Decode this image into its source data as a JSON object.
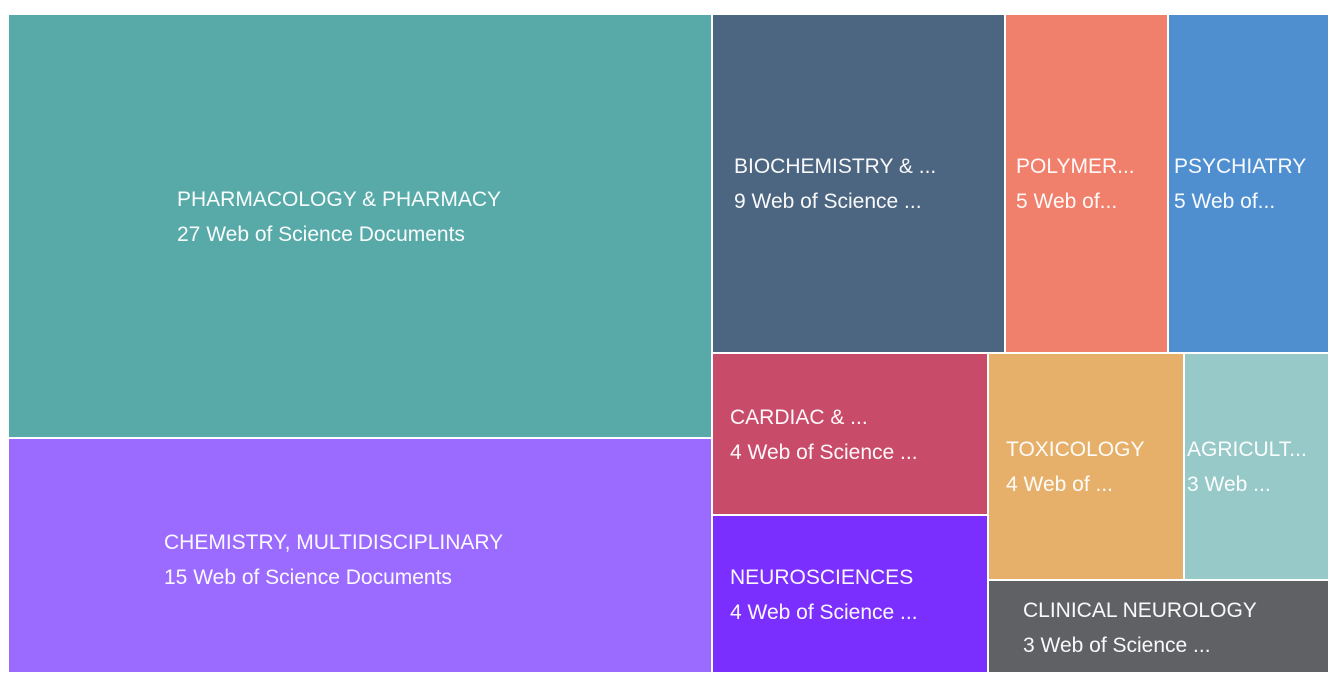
{
  "chart_data": {
    "type": "treemap",
    "title": "",
    "unit_label": "Web of Science Documents",
    "items": [
      {
        "name": "PHARMACOLOGY & PHARMACY",
        "value": 27,
        "label": "PHARMACOLOGY & PHARMACY",
        "sub": "27 Web of Science Documents",
        "color": "#58AAA8"
      },
      {
        "name": "CHEMISTRY, MULTIDISCIPLINARY",
        "value": 15,
        "label": "CHEMISTRY, MULTIDISCIPLINARY",
        "sub": "15 Web of Science Documents",
        "color": "#9B6BFF"
      },
      {
        "name": "BIOCHEMISTRY & ...",
        "value": 9,
        "label": "BIOCHEMISTRY & ...",
        "sub": "9 Web of Science ...",
        "color": "#4C6580"
      },
      {
        "name": "POLYMER...",
        "value": 5,
        "label": "POLYMER...",
        "sub": "5 Web of...",
        "color": "#F07F6B"
      },
      {
        "name": "PSYCHIATRY",
        "value": 5,
        "label": "PSYCHIATRY",
        "sub": "5 Web of...",
        "color": "#4F8FD0"
      },
      {
        "name": "CARDIAC & ...",
        "value": 4,
        "label": "CARDIAC & ...",
        "sub": "4 Web of Science ...",
        "color": "#C94B6A"
      },
      {
        "name": "NEUROSCIENCES",
        "value": 4,
        "label": "NEUROSCIENCES",
        "sub": "4 Web of Science ...",
        "color": "#7B2FFF"
      },
      {
        "name": "TOXICOLOGY",
        "value": 4,
        "label": "TOXICOLOGY",
        "sub": "4 Web of ...",
        "color": "#E6B06A"
      },
      {
        "name": "AGRICULT...",
        "value": 3,
        "label": "AGRICULT...",
        "sub": "3 Web ...",
        "color": "#97C9C8"
      },
      {
        "name": "CLINICAL NEUROLOGY",
        "value": 3,
        "label": "CLINICAL NEUROLOGY",
        "sub": "3 Web of Science ...",
        "color": "#5F6165"
      }
    ]
  }
}
